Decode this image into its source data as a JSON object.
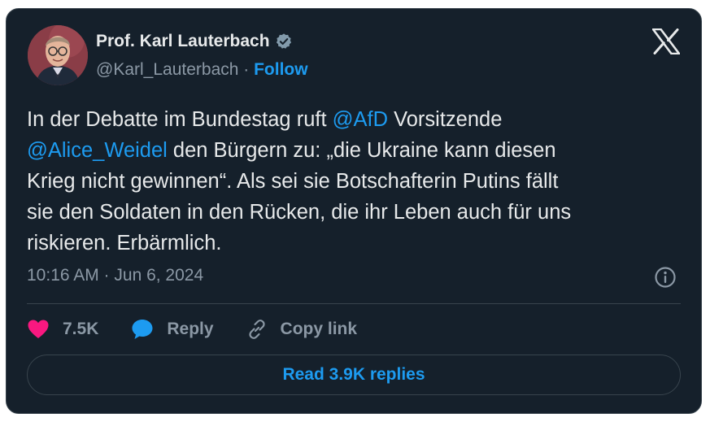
{
  "author": {
    "name": "Prof. Karl Lauterbach",
    "handle": "@Karl_Lauterbach",
    "separator": " · ",
    "follow_label": "Follow",
    "avatar_icon": "profile-photo",
    "verified_icon": "verified-badge-icon"
  },
  "tweet": {
    "segments": [
      {
        "text": "In der Debatte im Bundestag ruft ",
        "mention": false
      },
      {
        "text": "@AfD",
        "mention": true
      },
      {
        "text": " Vorsitzende\n",
        "mention": false
      },
      {
        "text": "@Alice_Weidel",
        "mention": true
      },
      {
        "text": " den Bürgern zu: „die Ukraine kann diesen\nKrieg nicht gewinnen“. Als sei sie Botschafterin Putins fällt\nsie den Soldaten in den Rücken, die ihr Leben auch für uns\nriskieren. Erbärmlich.",
        "mention": false
      }
    ],
    "timestamp": "10:16 AM · Jun 6, 2024"
  },
  "actions": {
    "likes": "7.5K",
    "reply_label": "Reply",
    "copy_link_label": "Copy link"
  },
  "replies_button_label": "Read 3.9K replies",
  "colors": {
    "background": "#15202b",
    "accent": "#1d9bf0",
    "like": "#f91880",
    "text": "#e7e9ea",
    "muted": "#8b98a5",
    "border": "#38444d"
  }
}
